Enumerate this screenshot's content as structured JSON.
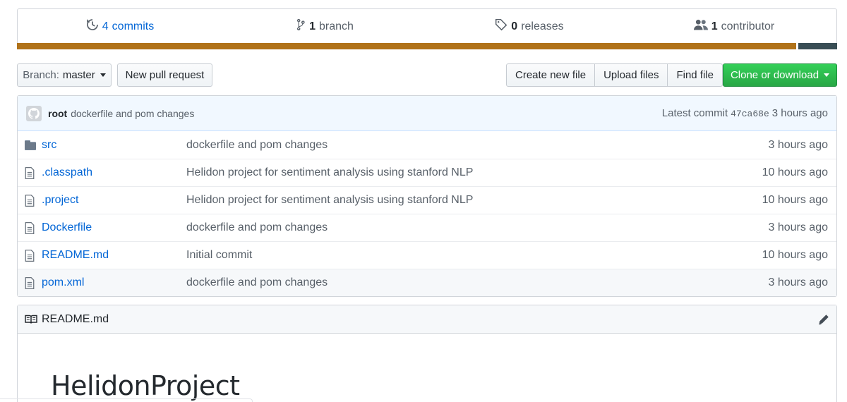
{
  "summary": {
    "commits": {
      "count": "4",
      "label": "commits"
    },
    "branches": {
      "count": "1",
      "label": "branch"
    },
    "releases": {
      "count": "0",
      "label": "releases"
    },
    "contributors": {
      "count": "1",
      "label": "contributor"
    }
  },
  "language_bar": [
    {
      "share": 0.95,
      "color": "#b07219"
    },
    {
      "share": 0.047,
      "color": "#384d54"
    }
  ],
  "toolbar": {
    "branch_prefix": "Branch:",
    "branch_name": "master",
    "new_pr": "New pull request",
    "create_file": "Create new file",
    "upload_files": "Upload files",
    "find_file": "Find file",
    "clone": "Clone or download"
  },
  "latest_commit": {
    "author": "root",
    "message": "dockerfile and pom changes",
    "label": "Latest commit",
    "sha": "47ca68e",
    "age": "3 hours ago"
  },
  "files": [
    {
      "type": "dir",
      "name": "src",
      "message": "dockerfile and pom changes",
      "age": "3 hours ago"
    },
    {
      "type": "file",
      "name": ".classpath",
      "message": "Helidon project for sentiment analysis using stanford NLP",
      "age": "10 hours ago"
    },
    {
      "type": "file",
      "name": ".project",
      "message": "Helidon project for sentiment analysis using stanford NLP",
      "age": "10 hours ago"
    },
    {
      "type": "file",
      "name": "Dockerfile",
      "message": "dockerfile and pom changes",
      "age": "3 hours ago"
    },
    {
      "type": "file",
      "name": "README.md",
      "message": "Initial commit",
      "age": "10 hours ago"
    },
    {
      "type": "file",
      "name": "pom.xml",
      "message": "dockerfile and pom changes",
      "age": "3 hours ago"
    }
  ],
  "readme": {
    "filename": "README.md",
    "heading": "HelidonProject"
  },
  "icons": {
    "commits": "history-icon",
    "branch": "git-branch-icon",
    "releases": "tag-icon",
    "contributors": "people-icon",
    "folder": "folder-icon",
    "file": "file-icon",
    "book": "book-icon",
    "edit": "pencil-icon"
  }
}
